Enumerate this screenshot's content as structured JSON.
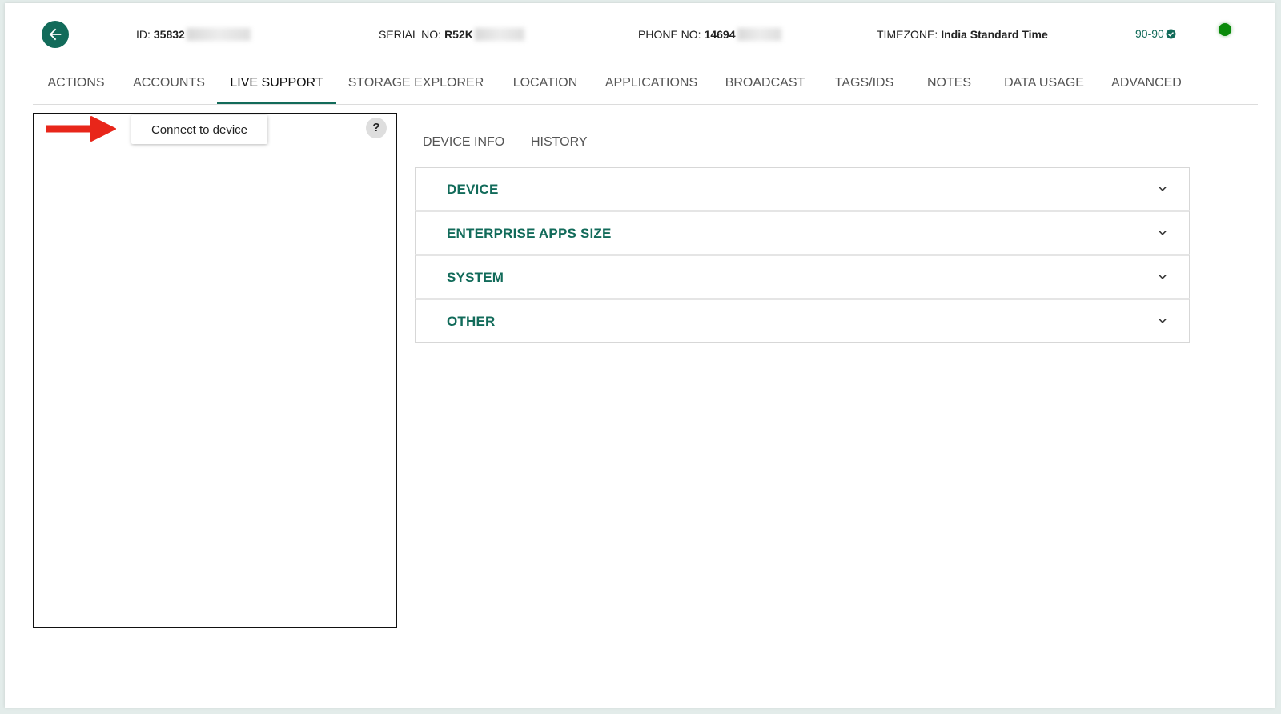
{
  "header": {
    "id_label": "ID:",
    "id_value": "35832",
    "serial_label": "SERIAL NO:",
    "serial_value": "R52K",
    "phone_label": "PHONE NO:",
    "phone_value": "14694",
    "timezone_label": "TIMEZONE:",
    "timezone_value": "India Standard Time",
    "status_text": "90-90"
  },
  "tabs": [
    {
      "label": "ACTIONS"
    },
    {
      "label": "ACCOUNTS"
    },
    {
      "label": "LIVE SUPPORT",
      "active": true
    },
    {
      "label": "STORAGE EXPLORER"
    },
    {
      "label": "LOCATION"
    },
    {
      "label": "APPLICATIONS"
    },
    {
      "label": "BROADCAST"
    },
    {
      "label": "TAGS/IDS"
    },
    {
      "label": "NOTES"
    },
    {
      "label": "DATA USAGE"
    },
    {
      "label": "ADVANCED"
    }
  ],
  "live_support": {
    "connect_label": "Connect to device",
    "help_label": "?"
  },
  "subtabs": [
    {
      "label": "DEVICE INFO"
    },
    {
      "label": "HISTORY"
    }
  ],
  "sections": [
    {
      "title": "DEVICE"
    },
    {
      "title": "ENTERPRISE APPS SIZE"
    },
    {
      "title": "SYSTEM"
    },
    {
      "title": "OTHER"
    }
  ],
  "colors": {
    "accent": "#126b5a",
    "status_online": "#0a8a0a",
    "annotation_arrow": "#e8261a"
  }
}
